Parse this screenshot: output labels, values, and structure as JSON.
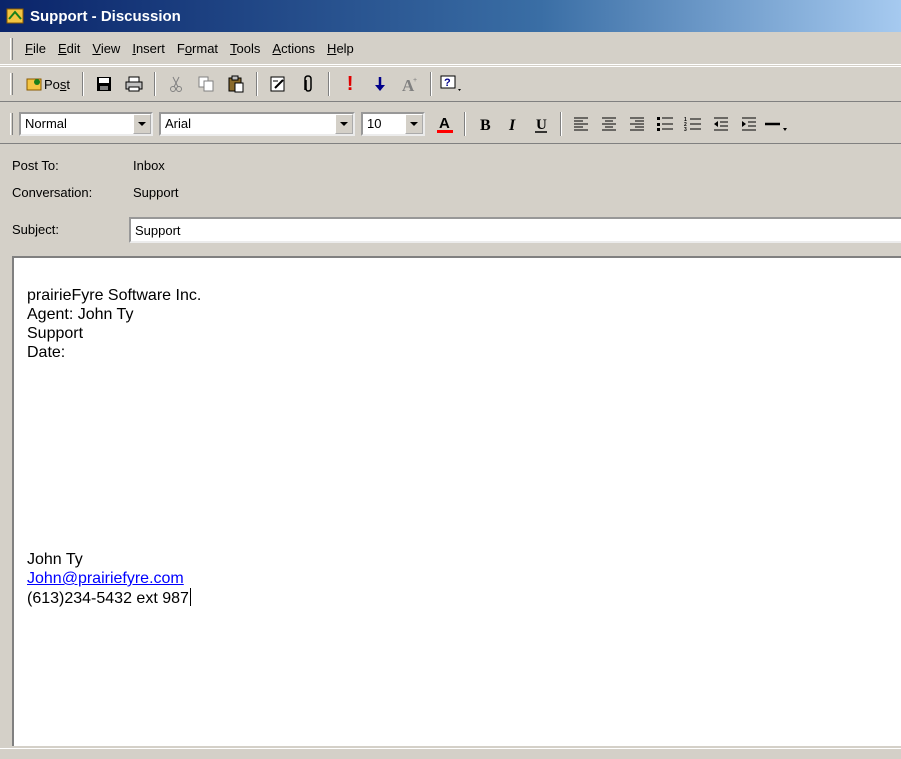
{
  "window": {
    "title": "Support - Discussion"
  },
  "menu": [
    {
      "pre": "",
      "key": "F",
      "post": "ile"
    },
    {
      "pre": "",
      "key": "E",
      "post": "dit"
    },
    {
      "pre": "",
      "key": "V",
      "post": "iew"
    },
    {
      "pre": "",
      "key": "I",
      "post": "nsert"
    },
    {
      "pre": "F",
      "key": "o",
      "post": "rmat"
    },
    {
      "pre": "",
      "key": "T",
      "post": "ools"
    },
    {
      "pre": "",
      "key": "A",
      "post": "ctions"
    },
    {
      "pre": "",
      "key": "H",
      "post": "elp"
    }
  ],
  "toolbar": {
    "post_label_a": "Po",
    "post_label_b": "s",
    "post_label_c": "t"
  },
  "format_toolbar": {
    "style": "Normal",
    "font": "Arial",
    "size": "10",
    "font_color": "#ff0000"
  },
  "fields": {
    "post_to_label": "Post To:",
    "post_to_value": "Inbox",
    "conversation_label": "Conversation:",
    "conversation_value": "Support",
    "subject_label": "Subject:",
    "subject_value": "Support"
  },
  "body": {
    "lines": [
      "prairieFyre Software Inc.",
      "Agent: John Ty",
      "Support",
      "Date:"
    ],
    "signature_name": "John Ty",
    "signature_email": "John@prairiefyre.com",
    "signature_phone": "(613)234-5432 ext 987"
  }
}
